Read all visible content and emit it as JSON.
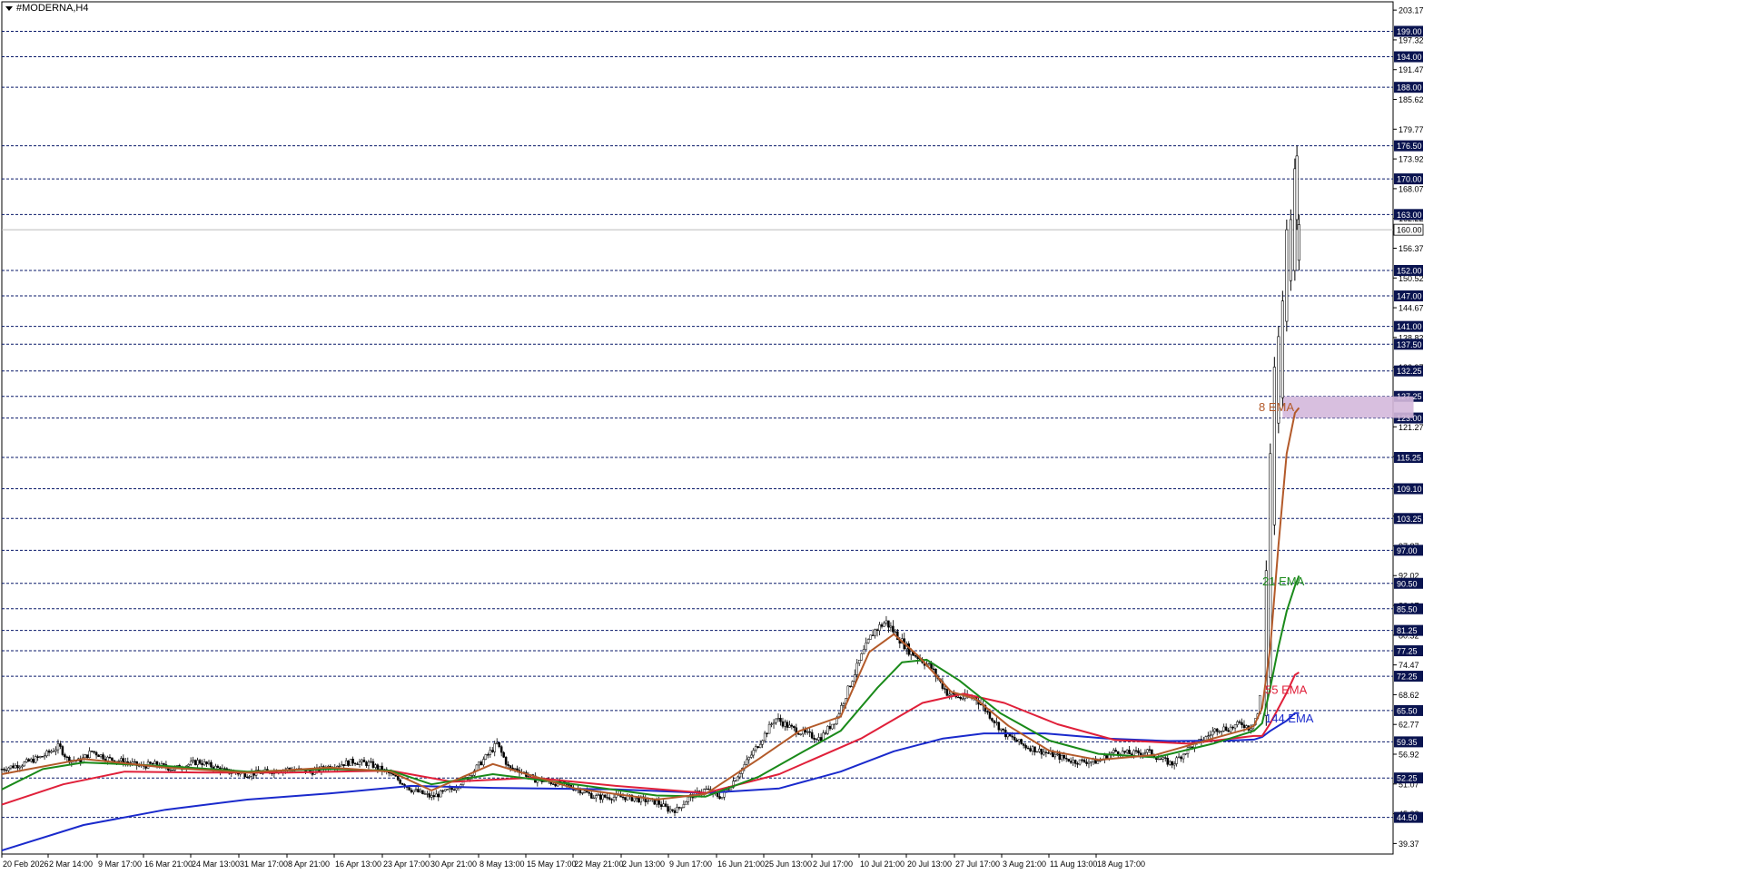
{
  "chart_data": {
    "type": "candlestick",
    "title": "#MODERNA,H4",
    "ylim": [
      37.3,
      204.8
    ],
    "axis_ticks_y": [
      "203.17",
      "197.32",
      "191.47",
      "185.62",
      "179.77",
      "173.92",
      "168.07",
      "162.22",
      "156.37",
      "150.52",
      "144.67",
      "138.82",
      "132.97",
      "127.12",
      "121.27",
      "115.42",
      "109.57",
      "103.72",
      "97.87",
      "92.02",
      "86.17",
      "80.32",
      "74.47",
      "68.62",
      "62.77",
      "56.92",
      "51.07",
      "45.22",
      "39.37"
    ],
    "levels": [
      "199.00",
      "194.00",
      "188.00",
      "176.50",
      "170.00",
      "163.00",
      "152.00",
      "147.00",
      "141.00",
      "137.50",
      "132.25",
      "127.25",
      "123.00",
      "115.25",
      "109.10",
      "103.25",
      "97.00",
      "90.50",
      "85.50",
      "81.25",
      "77.25",
      "72.25",
      "65.50",
      "59.35",
      "52.25",
      "44.50"
    ],
    "current_price": "160.00",
    "x_labels": [
      "20 Feb 2026",
      "2 Mar 14:00",
      "9 Mar 17:00",
      "16 Mar 21:00",
      "24 Mar 13:00",
      "31 Mar 17:00",
      "8 Apr 21:00",
      "16 Apr 13:00",
      "23 Apr 17:00",
      "30 Apr 21:00",
      "8 May 13:00",
      "15 May 17:00",
      "22 May 21:00",
      "2 Jun 13:00",
      "9 Jun 17:00",
      "16 Jun 21:00",
      "25 Jun 13:00",
      "2 Jul 17:00",
      "10 Jul 21:00",
      "20 Jul 13:00",
      "27 Jul 17:00",
      "3 Aug 21:00",
      "11 Aug 13:00",
      "18 Aug 17:00"
    ],
    "zone": {
      "low": 123.0,
      "high": 127.25,
      "label": "8 EMA"
    },
    "series": [
      {
        "name": "8 EMA",
        "color": "#b35a2a"
      },
      {
        "name": "21 EMA",
        "color": "#1a8a1a"
      },
      {
        "name": "55 EMA",
        "color": "#e0203a"
      },
      {
        "name": "144 EMA",
        "color": "#1a2acc"
      }
    ],
    "ema_labels": [
      {
        "text": "8 EMA",
        "color": "#b35a2a",
        "price": 125.1
      },
      {
        "text": "21 EMA",
        "color": "#1a8a1a",
        "price": 90.8
      },
      {
        "text": "55 EMA",
        "color": "#e0203a",
        "price": 69.5
      },
      {
        "text": "144 EMA",
        "color": "#1a2acc",
        "price": 63.9
      }
    ],
    "price_path": [
      [
        0,
        54
      ],
      [
        5,
        55
      ],
      [
        10,
        56.5
      ],
      [
        14,
        58.5
      ],
      [
        16,
        56
      ],
      [
        19,
        55.5
      ],
      [
        22,
        57.5
      ],
      [
        26,
        56
      ],
      [
        30,
        55.5
      ],
      [
        34,
        54.5
      ],
      [
        37,
        55
      ],
      [
        42,
        54
      ],
      [
        48,
        55.5
      ],
      [
        55,
        53.5
      ],
      [
        60,
        53
      ],
      [
        65,
        53.5
      ],
      [
        70,
        54
      ],
      [
        76,
        53.5
      ],
      [
        80,
        54.5
      ],
      [
        86,
        55.5
      ],
      [
        90,
        55
      ],
      [
        95,
        53
      ],
      [
        100,
        50
      ],
      [
        105,
        48.5
      ],
      [
        110,
        50
      ],
      [
        114,
        52.5
      ],
      [
        119,
        57
      ],
      [
        121,
        59
      ],
      [
        124,
        54
      ],
      [
        126,
        54
      ],
      [
        130,
        52
      ],
      [
        137,
        51
      ],
      [
        141,
        50
      ],
      [
        145,
        48.5
      ],
      [
        152,
        48.5
      ],
      [
        156,
        48
      ],
      [
        160,
        47.5
      ],
      [
        163,
        46
      ],
      [
        165,
        46
      ],
      [
        168,
        48.5
      ],
      [
        172,
        50
      ],
      [
        174,
        49
      ],
      [
        176,
        48.5
      ],
      [
        180,
        53
      ],
      [
        185,
        59
      ],
      [
        189,
        64
      ],
      [
        193,
        62
      ],
      [
        196,
        61
      ],
      [
        200,
        60
      ],
      [
        204,
        64
      ],
      [
        207,
        70
      ],
      [
        210,
        76
      ],
      [
        213,
        81
      ],
      [
        216,
        83
      ],
      [
        219,
        80
      ],
      [
        222,
        77
      ],
      [
        224,
        76
      ],
      [
        227,
        74
      ],
      [
        231,
        69
      ],
      [
        234,
        68
      ],
      [
        238,
        68
      ],
      [
        242,
        64
      ],
      [
        245,
        61
      ],
      [
        250,
        58.5
      ],
      [
        256,
        57
      ],
      [
        262,
        55.5
      ],
      [
        268,
        55.5
      ],
      [
        272,
        57.5
      ],
      [
        276,
        57
      ],
      [
        280,
        57.5
      ],
      [
        283,
        56
      ],
      [
        286,
        55
      ],
      [
        290,
        58
      ],
      [
        294,
        60
      ],
      [
        297,
        62
      ],
      [
        300,
        62
      ],
      [
        303,
        63
      ],
      [
        305,
        62
      ],
      [
        307,
        65
      ],
      [
        308,
        72
      ],
      [
        309,
        85
      ],
      [
        310,
        100
      ],
      [
        311,
        115
      ],
      [
        312,
        130
      ],
      [
        313,
        140
      ],
      [
        314,
        150
      ],
      [
        315,
        158
      ],
      [
        316,
        170
      ],
      [
        316.5,
        175
      ],
      [
        317,
        163
      ],
      [
        318,
        157
      ]
    ],
    "ema8": [
      [
        0,
        53
      ],
      [
        20,
        56
      ],
      [
        40,
        54.3
      ],
      [
        60,
        53.3
      ],
      [
        80,
        54.3
      ],
      [
        95,
        53.5
      ],
      [
        105,
        49.8
      ],
      [
        120,
        55
      ],
      [
        140,
        50.2
      ],
      [
        160,
        48
      ],
      [
        172,
        49.1
      ],
      [
        185,
        56
      ],
      [
        195,
        61.5
      ],
      [
        205,
        64.3
      ],
      [
        212,
        77
      ],
      [
        218,
        80.5
      ],
      [
        224,
        76.2
      ],
      [
        232,
        69.2
      ],
      [
        238,
        67.8
      ],
      [
        246,
        62.5
      ],
      [
        256,
        57.6
      ],
      [
        268,
        55.8
      ],
      [
        282,
        56.8
      ],
      [
        296,
        60
      ],
      [
        304,
        61.8
      ],
      [
        306,
        62.5
      ],
      [
        308,
        66
      ],
      [
        310,
        78
      ],
      [
        312,
        98
      ],
      [
        314,
        116
      ],
      [
        316,
        124
      ],
      [
        317,
        125
      ]
    ],
    "ema21": [
      [
        0,
        50
      ],
      [
        10,
        54
      ],
      [
        20,
        55.3
      ],
      [
        40,
        54.6
      ],
      [
        60,
        53.5
      ],
      [
        80,
        54
      ],
      [
        95,
        53.7
      ],
      [
        105,
        51
      ],
      [
        120,
        53
      ],
      [
        140,
        51
      ],
      [
        160,
        48.8
      ],
      [
        172,
        48.6
      ],
      [
        185,
        52.5
      ],
      [
        196,
        57.5
      ],
      [
        205,
        61.5
      ],
      [
        214,
        70
      ],
      [
        220,
        75
      ],
      [
        226,
        75.5
      ],
      [
        234,
        71.4
      ],
      [
        244,
        65
      ],
      [
        256,
        59.6
      ],
      [
        268,
        57
      ],
      [
        282,
        56.3
      ],
      [
        296,
        59
      ],
      [
        306,
        61.5
      ],
      [
        308,
        63
      ],
      [
        310,
        70
      ],
      [
        312,
        78
      ],
      [
        314,
        85
      ],
      [
        316,
        90
      ],
      [
        317,
        92
      ]
    ],
    "ema55": [
      [
        0,
        47
      ],
      [
        15,
        51
      ],
      [
        30,
        53.5
      ],
      [
        50,
        53.3
      ],
      [
        70,
        53.3
      ],
      [
        95,
        53.7
      ],
      [
        110,
        51.5
      ],
      [
        130,
        52.3
      ],
      [
        150,
        50.7
      ],
      [
        172,
        49.3
      ],
      [
        190,
        53
      ],
      [
        210,
        60
      ],
      [
        225,
        67
      ],
      [
        235,
        68.8
      ],
      [
        245,
        67
      ],
      [
        258,
        62.8
      ],
      [
        272,
        59.7
      ],
      [
        290,
        59
      ],
      [
        306,
        60.5
      ],
      [
        308,
        60.5
      ],
      [
        310,
        63
      ],
      [
        312,
        66
      ],
      [
        314,
        69
      ],
      [
        316,
        72.5
      ],
      [
        317,
        73
      ]
    ],
    "ema144": [
      [
        0,
        38
      ],
      [
        20,
        43
      ],
      [
        40,
        46
      ],
      [
        60,
        48
      ],
      [
        80,
        49.2
      ],
      [
        100,
        50.7
      ],
      [
        120,
        50.3
      ],
      [
        150,
        50
      ],
      [
        172,
        49.3
      ],
      [
        190,
        50.2
      ],
      [
        205,
        53.5
      ],
      [
        218,
        57.5
      ],
      [
        230,
        60
      ],
      [
        240,
        61
      ],
      [
        255,
        61
      ],
      [
        270,
        60
      ],
      [
        285,
        59.5
      ],
      [
        300,
        59.6
      ],
      [
        306,
        59.8
      ],
      [
        308,
        60.3
      ],
      [
        310,
        61.5
      ],
      [
        312,
        62.5
      ],
      [
        314,
        63.5
      ],
      [
        316,
        65
      ],
      [
        317,
        65
      ]
    ],
    "spikes": [
      [
        309,
        62.5,
        95
      ],
      [
        310,
        70,
        118
      ],
      [
        311,
        100,
        135
      ],
      [
        312,
        120,
        141
      ],
      [
        313,
        125,
        148
      ],
      [
        314,
        140,
        162
      ],
      [
        315,
        148,
        164
      ],
      [
        316,
        150,
        174
      ],
      [
        316.5,
        160,
        176.5
      ],
      [
        317,
        152,
        163
      ]
    ]
  }
}
